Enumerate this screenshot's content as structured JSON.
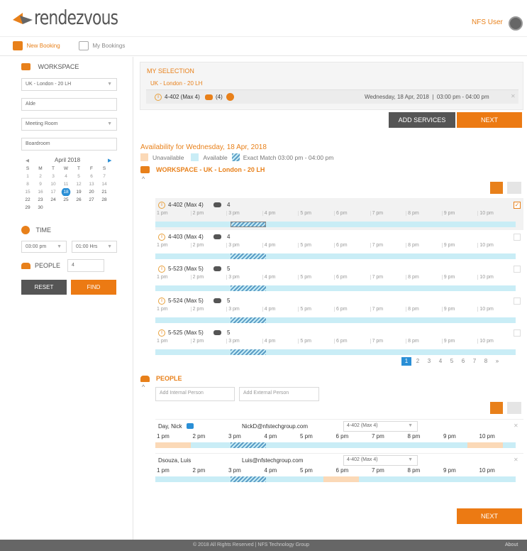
{
  "header": {
    "logo": "rendezvous",
    "user": "NFS User"
  },
  "nav": {
    "new_booking": "New Booking",
    "my_bookings": "My Bookings"
  },
  "sidebar": {
    "workspace_title": "WORKSPACE",
    "location_value": "UK - London - 20 LH",
    "search_value": "Alde",
    "type_value": "Meeting Room",
    "room_value": "Boardroom",
    "calendar": {
      "month": "April 2018",
      "weekdays": [
        "S",
        "M",
        "T",
        "W",
        "T",
        "F",
        "S"
      ],
      "weeks": [
        [
          "1",
          "2",
          "3",
          "4",
          "5",
          "6",
          "7"
        ],
        [
          "8",
          "9",
          "10",
          "11",
          "12",
          "13",
          "14"
        ],
        [
          "15",
          "16",
          "17",
          "18",
          "19",
          "20",
          "21"
        ],
        [
          "22",
          "23",
          "24",
          "25",
          "26",
          "27",
          "28"
        ],
        [
          "29",
          "30",
          "",
          "",
          "",
          "",
          ""
        ]
      ],
      "selected": "18"
    },
    "time_title": "TIME",
    "time_start": "03:00 pm",
    "time_duration": "01:00 Hrs",
    "people_title": "PEOPLE",
    "people_count": "4",
    "reset_label": "RESET",
    "find_label": "FIND"
  },
  "selection": {
    "title": "MY SELECTION",
    "location": "UK - London - 20 LH",
    "room": "4-402 (Max 4)",
    "people": "(4)",
    "datetime": "Wednesday, 18 Apr, 2018  |  03:00 pm - 04:00 pm",
    "add_services": "ADD SERVICES",
    "next": "NEXT"
  },
  "availability": {
    "title": "Availability for Wednesday, 18 Apr, 2018",
    "legend_unavailable": "Unavailable",
    "legend_available": "Available",
    "legend_match": "Exact Match 03:00 pm - 04:00 pm",
    "workspace_heading": "WORKSPACE - UK - London - 20 LH",
    "hours": [
      "1 pm",
      "2 pm",
      "3 pm",
      "4 pm",
      "5 pm",
      "6 pm",
      "7 pm",
      "8 pm",
      "9 pm",
      "10 pm"
    ],
    "rooms": [
      {
        "name": "4-402 (Max 4)",
        "count": "4",
        "checked": true
      },
      {
        "name": "4-403 (Max 4)",
        "count": "4",
        "checked": false
      },
      {
        "name": "5-523 (Max 5)",
        "count": "5",
        "checked": false
      },
      {
        "name": "5-524 (Max 5)",
        "count": "5",
        "checked": false
      },
      {
        "name": "5-525 (Max 5)",
        "count": "5",
        "checked": false
      }
    ],
    "pages": [
      "1",
      "2",
      "3",
      "4",
      "5",
      "6",
      "7",
      "8",
      "»"
    ]
  },
  "people": {
    "title": "PEOPLE",
    "internal_placeholder": "Add Internal Person",
    "external_placeholder": "Add External Person",
    "persons": [
      {
        "name": "Day, Nick",
        "email": "NickD@nfstechgroup.com",
        "room": "4-402 (Max 4)"
      },
      {
        "name": "Dsouza, Luis",
        "email": "Luis@nfstechgroup.com",
        "room": "4-402 (Max 4)"
      }
    ],
    "next": "NEXT"
  },
  "footer": {
    "copyright": "© 2018 All Rights Reserved | NFS Technology Group",
    "about": "About"
  },
  "colors": {
    "accent": "#ec7a13",
    "available": "#c9edf6",
    "match": "#5b9dc6",
    "dark": "#555555"
  }
}
